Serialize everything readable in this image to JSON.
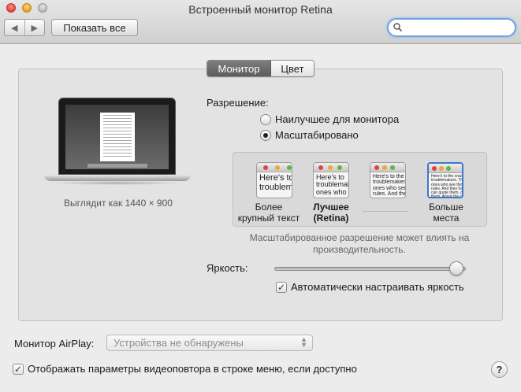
{
  "window": {
    "title": "Встроенный монитор Retina",
    "show_all": "Показать все",
    "search": {
      "value": "",
      "placeholder": ""
    }
  },
  "tabs": [
    {
      "label": "Монитор",
      "selected": true
    },
    {
      "label": "Цвет",
      "selected": false
    }
  ],
  "display": {
    "preview_caption": "Выглядит как 1440 × 900",
    "resolution_label": "Разрешение:",
    "resolution_options": [
      {
        "label": "Наилучшее для монитора",
        "selected": false
      },
      {
        "label": "Масштабировано",
        "selected": true
      }
    ],
    "scale_options": [
      {
        "preview_text": "Here's to\ntroublem",
        "label_line1": "Более",
        "label_line2": "крупный текст",
        "selected": false
      },
      {
        "preview_text": "Here's to\ntroublemak\nones who s",
        "label_line1": "Лучшее",
        "label_line2": "(Retina)",
        "selected": false
      },
      {
        "preview_text": "Here's to the cr\ntroublemakers.\nones who see t\nrules. And they",
        "label_line1": "",
        "label_line2": "",
        "selected": false
      },
      {
        "preview_text": "Here's to the crazy one\ntroublemakers. The ro\nones who see things d\nrules. And they have n\ncan quote them, disag\nthem. About the only t\nBecause they change",
        "label_line1": "Больше",
        "label_line2": "места",
        "selected": true
      }
    ],
    "scale_note": "Масштабированное разрешение может влиять на производительность.",
    "brightness_label": "Яркость:",
    "brightness_level": 0.95,
    "auto_brightness": {
      "label": "Автоматически настраивать яркость",
      "checked": true
    }
  },
  "airplay": {
    "label": "Монитор AirPlay:",
    "selected": "Устройства не обнаружены"
  },
  "mirroring_menu": {
    "label": "Отображать параметры видеоповтора в строке меню, если доступно",
    "checked": true
  },
  "help_label": "?",
  "colors": {
    "accent": "#3d79c9",
    "selected_tab": "#6a6a6a"
  }
}
